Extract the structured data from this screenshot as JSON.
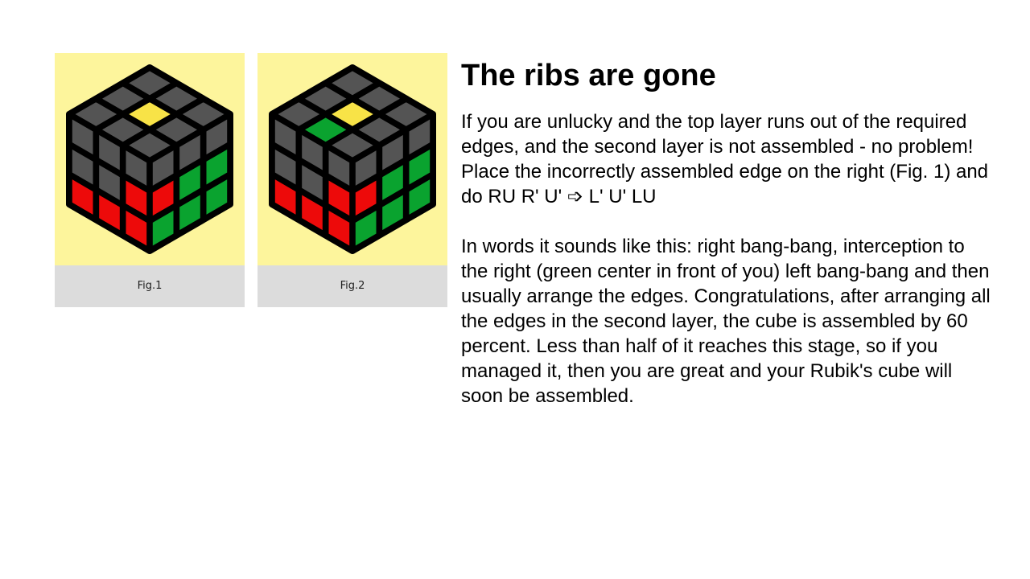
{
  "colors": {
    "background": "#ffffff",
    "figure_bg": "#fdf59c",
    "caption_bg": "#dcdcdc",
    "gray": "#545454",
    "yellow": "#f8e347",
    "red": "#ed0a0a",
    "green": "#0aa32f"
  },
  "figures": [
    {
      "caption": "Fig.1",
      "top": [
        "g",
        "g",
        "g",
        "g",
        "y",
        "g",
        "g",
        "g",
        "g"
      ],
      "left": [
        "g",
        "g",
        "g",
        "g",
        "g",
        "r",
        "r",
        "r",
        "r"
      ],
      "right": [
        "g",
        "g",
        "g",
        "r",
        "g",
        "g",
        "g",
        "g",
        "g"
      ]
    },
    {
      "caption": "Fig.2",
      "top": [
        "g",
        "g",
        "g",
        "g",
        "y",
        "g",
        "g",
        "G",
        "g"
      ],
      "left": [
        "g",
        "g",
        "g",
        "g",
        "g",
        "r",
        "r",
        "r",
        "r"
      ],
      "right": [
        "g",
        "g",
        "g",
        "R",
        "g",
        "g",
        "g",
        "g",
        "g"
      ]
    }
  ],
  "article": {
    "title": "The ribs are gone",
    "paragraph1": "If you are unlucky and the top layer runs out of the required edges, and the second layer is not assembled - no problem! Place the incorrectly assembled edge on the right (Fig. 1) and do RU R' U' ➩ L' U' LU",
    "paragraph2": "In words it sounds like this: right bang-bang, interception to the right (green center in front of you) left bang-bang and then usually arrange the edges. Congratulations, after arranging all the edges in the second layer, the cube is assembled by 60 percent. Less than half of it reaches this stage, so if you managed it, then you are great and your Rubik's cube will soon be assembled."
  }
}
